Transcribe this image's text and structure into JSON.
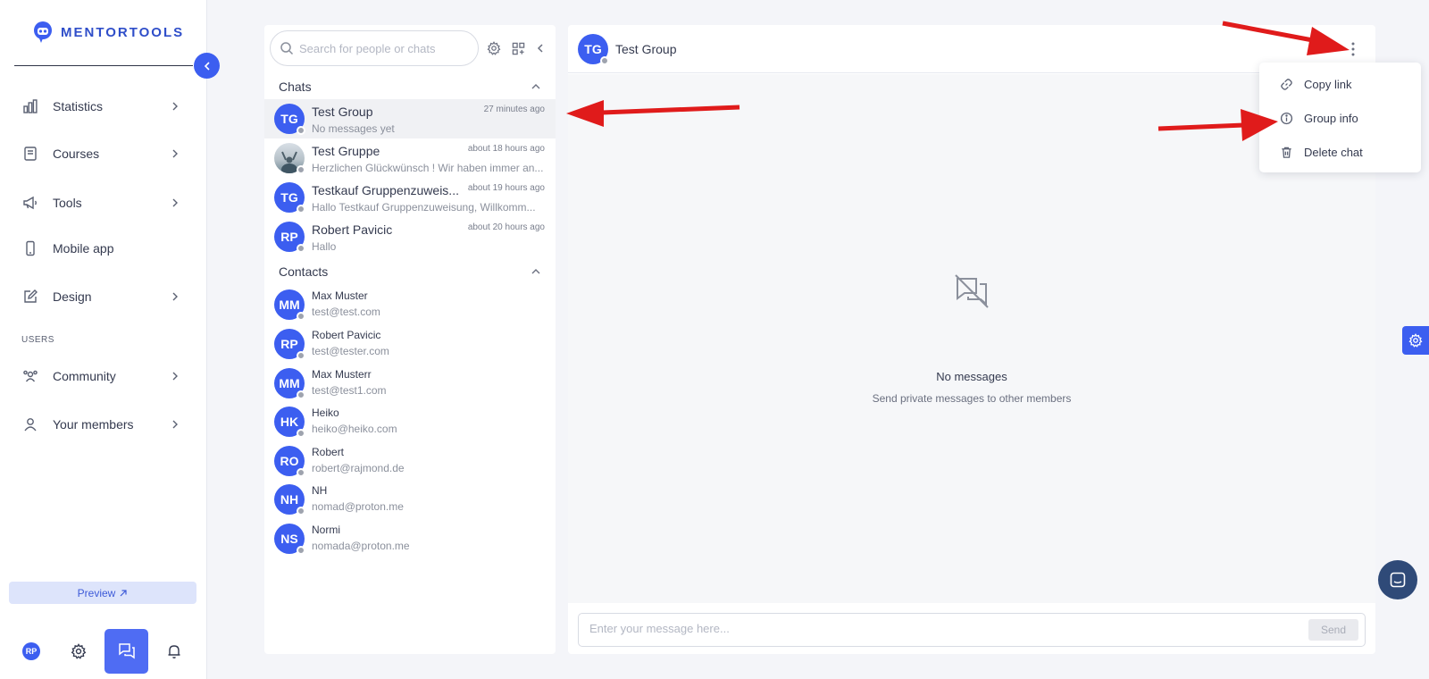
{
  "brand": {
    "name": "MENTORTOOLS",
    "accent": "#3c5ef0"
  },
  "sidebar": {
    "items": [
      {
        "label": "Statistics",
        "icon": "bar-chart-icon"
      },
      {
        "label": "Courses",
        "icon": "book-icon"
      },
      {
        "label": "Tools",
        "icon": "megaphone-icon"
      },
      {
        "label": "Mobile app",
        "icon": "mobile-icon"
      },
      {
        "label": "Design",
        "icon": "pencil-icon"
      },
      {
        "label": "Community",
        "icon": "users-icon"
      },
      {
        "label": "Your members",
        "icon": "user-icon"
      }
    ],
    "section_users": "USERS",
    "preview_label": "Preview",
    "user_initials": "RP"
  },
  "chat_list": {
    "search_placeholder": "Search for people or chats",
    "chats_header": "Chats",
    "contacts_header": "Contacts",
    "chats": [
      {
        "initials": "TG",
        "name": "Test Group",
        "time": "27 minutes ago",
        "preview": "No messages yet"
      },
      {
        "initials": "",
        "name": "Test Gruppe",
        "time": "about 18 hours ago",
        "preview": "Herzlichen Glückwünsch ! Wir haben immer an..."
      },
      {
        "initials": "TG",
        "name": "Testkauf Gruppenzuweis...",
        "time": "about 19 hours ago",
        "preview": "Hallo Testkauf Gruppenzuweisung, Willkomm..."
      },
      {
        "initials": "RP",
        "name": "Robert Pavicic",
        "time": "about 20 hours ago",
        "preview": "Hallo"
      }
    ],
    "contacts": [
      {
        "initials": "MM",
        "name": "Max Muster",
        "email": "test@test.com"
      },
      {
        "initials": "RP",
        "name": "Robert Pavicic",
        "email": "test@tester.com"
      },
      {
        "initials": "MM",
        "name": "Max Musterr",
        "email": "test@test1.com"
      },
      {
        "initials": "HK",
        "name": "Heiko",
        "email": "heiko@heiko.com"
      },
      {
        "initials": "RO",
        "name": "Robert",
        "email": "robert@rajmond.de"
      },
      {
        "initials": "NH",
        "name": "NH",
        "email": "nomad@proton.me"
      },
      {
        "initials": "NS",
        "name": "Normi",
        "email": "nomada@proton.me"
      }
    ]
  },
  "conversation": {
    "initials": "TG",
    "title": "Test Group",
    "empty_title": "No messages",
    "empty_subtitle": "Send private messages to other members",
    "input_placeholder": "Enter your message here...",
    "send_label": "Send"
  },
  "menu": {
    "items": [
      {
        "label": "Copy link",
        "icon": "link-icon"
      },
      {
        "label": "Group info",
        "icon": "info-icon"
      },
      {
        "label": "Delete chat",
        "icon": "trash-icon"
      }
    ]
  },
  "annotation_color": "#e01b1b"
}
